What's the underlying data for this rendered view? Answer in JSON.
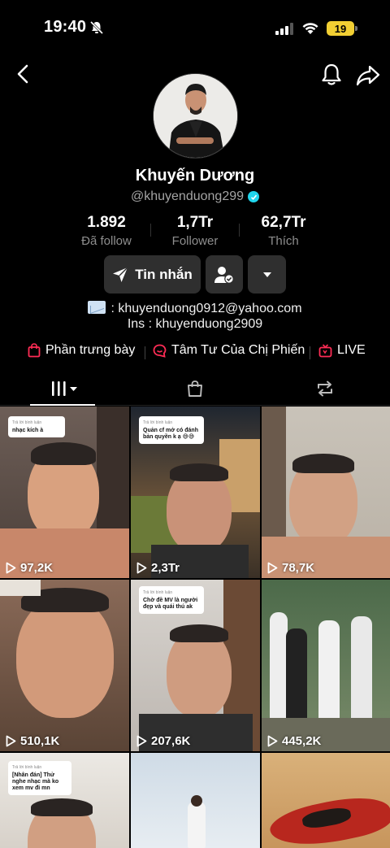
{
  "status_bar": {
    "time": "19:40",
    "battery": "19"
  },
  "profile": {
    "display_name": "Khuyến Dương",
    "handle": "@khuyenduong299",
    "verified": true
  },
  "stats": [
    {
      "value": "1.892",
      "label": "Đã follow"
    },
    {
      "value": "1,7Tr",
      "label": "Follower"
    },
    {
      "value": "62,7Tr",
      "label": "Thích"
    }
  ],
  "actions": {
    "message_label": "Tin nhắn"
  },
  "bio": {
    "line1": ": khuyenduong0912@yahoo.com",
    "line2": "Ins : khuyenduong2909"
  },
  "links": [
    {
      "label": "Phần trưng bày",
      "icon": "shopping-bag-icon"
    },
    {
      "label": "Tâm Tư Của Chị Phiến",
      "icon": "chat-bubble-icon"
    },
    {
      "label": "LIVE",
      "icon": "live-tv-icon"
    }
  ],
  "tabs": [
    {
      "name": "videos",
      "icon": "grid-bars-icon",
      "active": true
    },
    {
      "name": "shop",
      "icon": "shopping-bag-icon",
      "active": false
    },
    {
      "name": "reposts",
      "icon": "repost-icon",
      "active": false
    }
  ],
  "videos": [
    {
      "views": "97,2K",
      "comment": "nhạc kích à"
    },
    {
      "views": "2,3Tr",
      "comment": "Quản cf mở có đánh bản quyền k ạ 😅😅"
    },
    {
      "views": "78,7K",
      "comment": ""
    },
    {
      "views": "510,1K",
      "comment": ""
    },
    {
      "views": "207,6K",
      "comment": "Chờ đề MV là người đẹp và quái thú ak"
    },
    {
      "views": "445,2K",
      "comment": ""
    },
    {
      "views": "",
      "comment": "[Nhân đán] Thử nghe nhạc mà ko xem mv đi mn"
    },
    {
      "views": "",
      "comment": ""
    },
    {
      "views": "",
      "comment": ""
    }
  ],
  "colors": {
    "accent_red": "#fe2c55",
    "verified": "#20d5ec",
    "button_bg": "#2f2f2f"
  }
}
